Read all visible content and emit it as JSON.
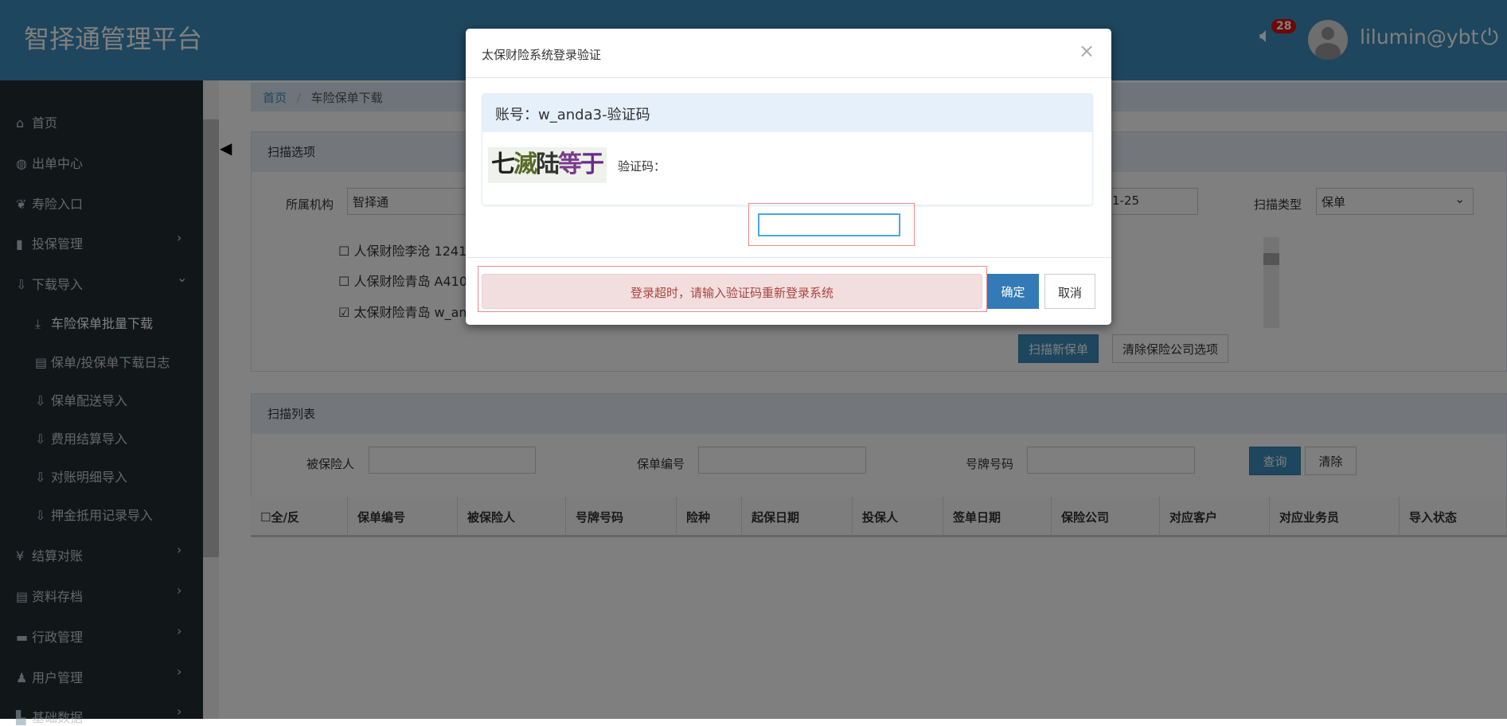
{
  "header": {
    "title": "智择通管理平台",
    "notification_count": "28",
    "username": "lilumin@ybt"
  },
  "sidebar": {
    "items": [
      {
        "label": "首页",
        "icon": "⌂"
      },
      {
        "label": "出单中心",
        "icon": "◍"
      },
      {
        "label": "寿险入口",
        "icon": "❦"
      },
      {
        "label": "投保管理",
        "icon": "▮"
      },
      {
        "label": "下载导入",
        "icon": "⇩"
      },
      {
        "label": "车险保单批量下载",
        "icon": "⤓"
      },
      {
        "label": "保单/投保单下载日志",
        "icon": "▤"
      },
      {
        "label": "保单配送导入",
        "icon": "⇩"
      },
      {
        "label": "费用结算导入",
        "icon": "⇩"
      },
      {
        "label": "对账明细导入",
        "icon": "⇩"
      },
      {
        "label": "押金抵用记录导入",
        "icon": "⇩"
      },
      {
        "label": "结算对账",
        "icon": "¥"
      },
      {
        "label": "资料存档",
        "icon": "▤"
      },
      {
        "label": "行政管理",
        "icon": "▬"
      },
      {
        "label": "用户管理",
        "icon": "♟"
      },
      {
        "label": "基础数据",
        "icon": "▙"
      }
    ]
  },
  "breadcrumb": {
    "home": "首页",
    "separator": "/",
    "current": "车险保单下载"
  },
  "scan_options": {
    "title": "扫描选项",
    "org_label": "所属机构",
    "org_value": "智择通",
    "date_value": "1-25",
    "type_label": "扫描类型",
    "type_value": "保单",
    "companies": [
      {
        "label": "人保财险李沧 1241",
        "checked": false
      },
      {
        "label": "人保财险青岛 A410",
        "checked": false
      },
      {
        "label": "太保财险青岛 w_an",
        "checked": true
      }
    ],
    "scan_button": "扫描新保单",
    "clear_button": "清除保险公司选项"
  },
  "scan_list": {
    "title": "扫描列表",
    "insured_label": "被保险人",
    "policy_label": "保单编号",
    "plate_label": "号牌号码",
    "query_button": "查询",
    "clear_button": "清除",
    "columns": [
      "☐全/反",
      "保单编号",
      "被保险人",
      "号牌号码",
      "险种",
      "起保日期",
      "投保人",
      "签单日期",
      "保险公司",
      "对应客户",
      "对应业务员",
      "导入状态"
    ]
  },
  "modal": {
    "title": "太保财险系统登录验证",
    "close": "×",
    "account_heading": "账号：w_anda3-验证码",
    "captcha_chars": [
      "七",
      "滅",
      "陆",
      "等",
      "于"
    ],
    "captcha_label": "验证码：",
    "captcha_value": "",
    "alert": "登录超时，请输入验证码重新登录系统",
    "ok_button": "确定",
    "cancel_button": "取消"
  }
}
